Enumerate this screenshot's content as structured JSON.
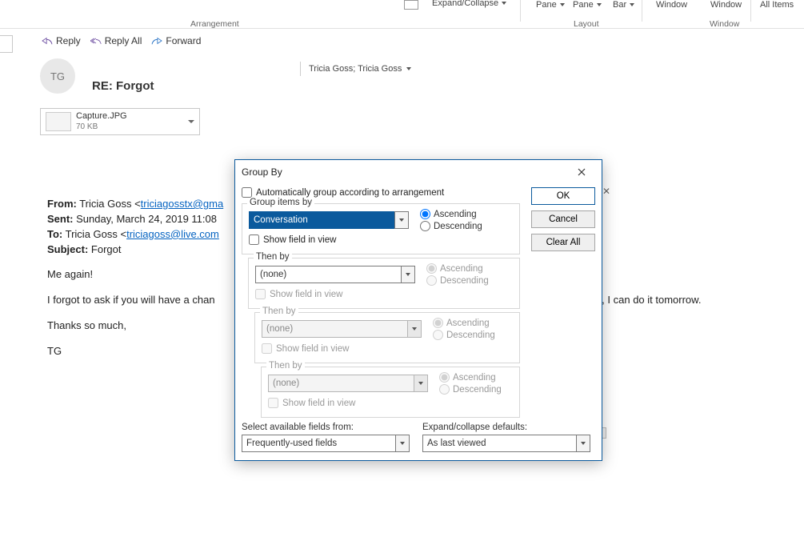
{
  "ribbon": {
    "expand_collapse": "Expand/Collapse",
    "pane1": "Pane",
    "pane2": "Pane",
    "bar": "Bar",
    "window1": "Window",
    "window2": "Window",
    "all_items": "All Items",
    "group_arrangement": "Arrangement",
    "group_layout": "Layout",
    "group_window": "Window"
  },
  "actions": {
    "reply": "Reply",
    "reply_all": "Reply All",
    "forward": "Forward"
  },
  "message": {
    "avatar_initials": "TG",
    "subject": "RE: Forgot",
    "to_display": "Tricia Goss; Tricia Goss",
    "attachment_name": "Capture.JPG",
    "attachment_size": "70 KB",
    "from_label": "From:",
    "from_name": " Tricia Goss <",
    "from_email": "triciagosstx@gma",
    "sent_label": "Sent:",
    "sent_value": " Sunday, March 24, 2019 11:08",
    "to_label": "To:",
    "to_name": " Tricia Goss <",
    "to_email": "triciagoss@live.com",
    "subj_label": "Subject:",
    "subj_value": " Forgot",
    "p1": "Me again!",
    "p2a": "I forgot to ask if you will have a chan",
    "p2b": "t, I can do it tomorrow.",
    "p3": "Thanks so much,",
    "p4": "TG"
  },
  "dialog": {
    "title": "Group By",
    "auto_group": "Automatically group according to arrangement",
    "ok": "OK",
    "cancel": "Cancel",
    "clear_all": "Clear All",
    "group_items_by": "Group items by",
    "then_by": "Then by",
    "conversation": "Conversation",
    "none": "(none)",
    "show_field": "Show field in view",
    "ascending": "Ascending",
    "descending": "Descending",
    "select_fields_label": "Select available fields from:",
    "select_fields_value": "Frequently-used fields",
    "expand_label": "Expand/collapse defaults:",
    "expand_value": "As last viewed"
  }
}
